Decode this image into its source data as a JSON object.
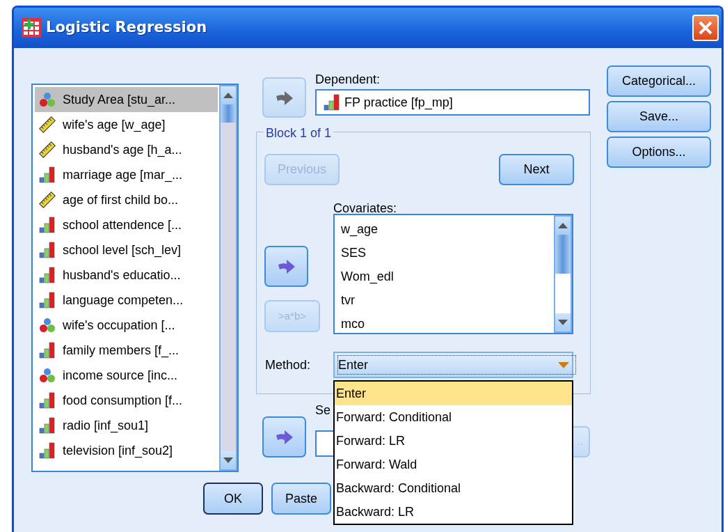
{
  "window": {
    "title": "Logistic Regression"
  },
  "variables": [
    {
      "label": "Study Area [stu_ar...",
      "kind": "nominal",
      "selected": true
    },
    {
      "label": "wife's age [w_age]",
      "kind": "scale",
      "selected": false
    },
    {
      "label": "husband's age [h_a...",
      "kind": "scale",
      "selected": false
    },
    {
      "label": "marriage age [mar_...",
      "kind": "ordinal",
      "selected": false
    },
    {
      "label": "age of first child bo...",
      "kind": "scale",
      "selected": false
    },
    {
      "label": "school attendence [...",
      "kind": "ordinal",
      "selected": false
    },
    {
      "label": "school level [sch_lev]",
      "kind": "ordinal",
      "selected": false
    },
    {
      "label": "husband's educatio...",
      "kind": "ordinal",
      "selected": false
    },
    {
      "label": "language competen...",
      "kind": "ordinal",
      "selected": false
    },
    {
      "label": "wife's occupation [...",
      "kind": "nominal",
      "selected": false
    },
    {
      "label": "family members [f_...",
      "kind": "ordinal",
      "selected": false
    },
    {
      "label": "income source [inc...",
      "kind": "nominal",
      "selected": false
    },
    {
      "label": "food consumption [f...",
      "kind": "ordinal",
      "selected": false
    },
    {
      "label": "radio [inf_sou1]",
      "kind": "ordinal",
      "selected": false
    },
    {
      "label": "television [inf_sou2]",
      "kind": "ordinal",
      "selected": false
    }
  ],
  "dependent": {
    "label": "Dependent:",
    "value": "FP practice [fp_mp]",
    "kind": "ordinal",
    "arrow_disabled": true
  },
  "block": {
    "title": "Block 1 of 1",
    "previous": {
      "label": "Previous",
      "disabled": true
    },
    "next": {
      "label": "Next",
      "disabled": false
    }
  },
  "covariates": {
    "label": "Covariates:",
    "arrow_disabled": false,
    "items": [
      "w_age",
      "SES",
      "Wom_edl",
      "tvr",
      "mco"
    ]
  },
  "interaction_button": {
    "label": ">a*b>",
    "disabled": true
  },
  "method": {
    "label": "Method:",
    "value": "Enter",
    "options": [
      {
        "label": "Enter",
        "selected": true
      },
      {
        "label": "Forward: Conditional",
        "selected": false
      },
      {
        "label": "Forward: LR",
        "selected": false
      },
      {
        "label": "Forward: Wald",
        "selected": false
      },
      {
        "label": "Backward: Conditional",
        "selected": false
      },
      {
        "label": "Backward: LR",
        "selected": false
      }
    ]
  },
  "selection": {
    "label": "Se",
    "arrow_disabled": false,
    "rule_button": {
      "label": "..",
      "disabled": true
    }
  },
  "side_buttons": [
    "Categorical...",
    "Save...",
    "Options..."
  ],
  "bottom_buttons": [
    {
      "label": "OK",
      "default": true
    },
    {
      "label": "Paste",
      "default": false
    }
  ]
}
